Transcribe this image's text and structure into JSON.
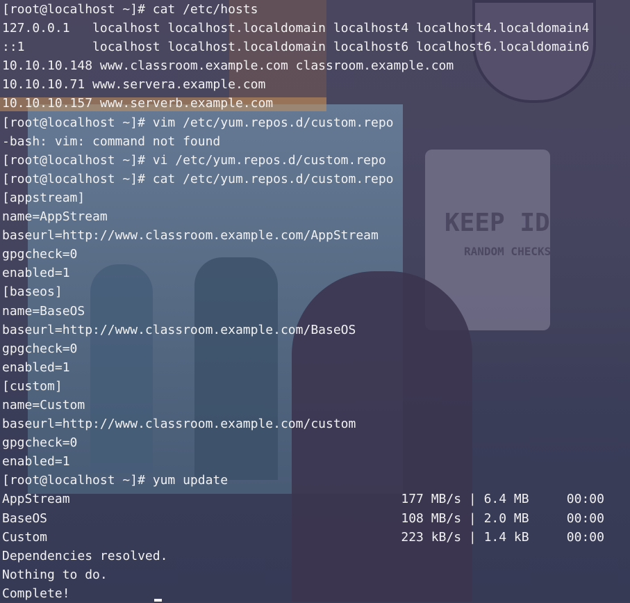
{
  "terminal": {
    "lines": [
      "[root@localhost ~]# cat /etc/hosts",
      "127.0.0.1   localhost localhost.localdomain localhost4 localhost4.localdomain4",
      "::1         localhost localhost.localdomain localhost6 localhost6.localdomain6",
      "10.10.10.148 www.classroom.example.com classroom.example.com",
      "10.10.10.71 www.servera.example.com",
      "10.10.10.157 www.serverb.example.com",
      "[root@localhost ~]# vim /etc/yum.repos.d/custom.repo",
      "-bash: vim: command not found",
      "[root@localhost ~]# vi /etc/yum.repos.d/custom.repo",
      "[root@localhost ~]# cat /etc/yum.repos.d/custom.repo",
      "[appstream]",
      "name=AppStream",
      "baseurl=http://www.classroom.example.com/AppStream",
      "gpgcheck=0",
      "enabled=1",
      "[baseos]",
      "name=BaseOS",
      "baseurl=http://www.classroom.example.com/BaseOS",
      "gpgcheck=0",
      "enabled=1",
      "[custom]",
      "name=Custom",
      "baseurl=http://www.classroom.example.com/custom",
      "gpgcheck=0",
      "enabled=1",
      "[root@localhost ~]# yum update",
      "AppStream                                            177 MB/s | 6.4 MB     00:00",
      "BaseOS                                               108 MB/s | 2.0 MB     00:00",
      "Custom                                               223 kB/s | 1.4 kB     00:00",
      "Dependencies resolved.",
      "Nothing to do.",
      "Complete!"
    ]
  },
  "wallpaper": {
    "sign_text": "KEEP ID",
    "sign_sub": "RANDOM CHECKS"
  }
}
